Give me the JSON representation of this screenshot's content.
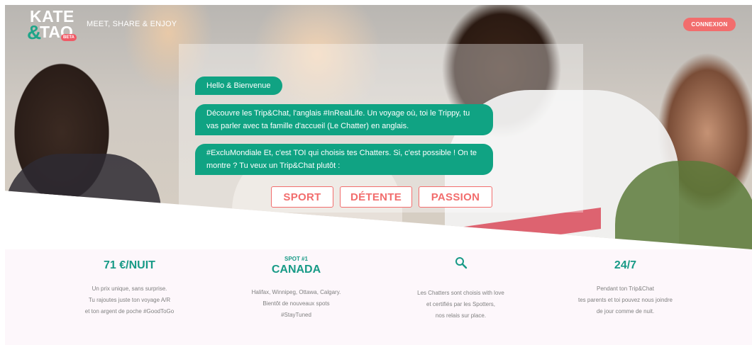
{
  "header": {
    "logo_line1": "KATE",
    "logo_amp": "&",
    "logo_line2": "TAO",
    "logo_badge": "BETA",
    "tagline": "MEET, SHARE & ENJOY",
    "connexion_label": "CONNEXION"
  },
  "chat": {
    "messages": [
      "Hello & Bienvenue",
      "Découvre les Trip&Chat, l'anglais #InRealLife. Un voyage où, toi le Trippy, tu vas parler avec ta famille d'accueil (Le Chatter) en anglais.",
      "#ExcluMondiale Et, c'est TOI qui choisis tes Chatters. Si, c'est possible ! On te montre ? Tu veux un Trip&Chat plutôt :"
    ],
    "choices": [
      "SPORT",
      "DÉTENTE",
      "PASSION"
    ]
  },
  "features": [
    {
      "title": "71 €/NUIT",
      "lines": [
        "Un prix unique, sans surprise.",
        "Tu rajoutes juste ton voyage A/R",
        "et ton argent de poche #GoodToGo"
      ]
    },
    {
      "kicker": "SPOT #1",
      "title": "CANADA",
      "lines": [
        "Halifax, Winnipeg, Ottawa, Calgary.",
        "Bientôt de nouveaux spots",
        "#StayTuned"
      ]
    },
    {
      "icon": "search-icon",
      "lines": [
        "Les Chatters sont choisis with love",
        "et certifiés par les Spotters,",
        "nos relais sur place."
      ]
    },
    {
      "title": "24/7",
      "lines": [
        "Pendant ton Trip&Chat",
        "tes parents et toi pouvez nous joindre",
        "de jour comme de nuit."
      ]
    }
  ],
  "colors": {
    "accent_green": "#10a383",
    "accent_coral": "#f26d6d",
    "feature_bg": "#fdf7fb"
  }
}
